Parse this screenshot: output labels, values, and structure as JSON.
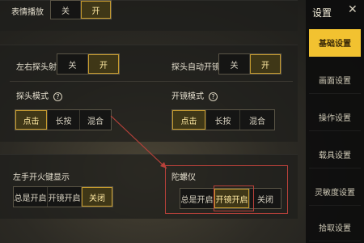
{
  "rows": {
    "top": {
      "label": "表情播放",
      "options": [
        "关",
        "开"
      ],
      "selected": 1
    },
    "lean_fire": {
      "label": "左右探头射击",
      "options": [
        "关",
        "开"
      ],
      "selected": 1
    },
    "auto_open_door": {
      "label": "探头自动开镜",
      "options": [
        "关",
        "开"
      ],
      "selected": 1
    },
    "peek_mode": {
      "label": "探头模式",
      "help": "?",
      "options": [
        "点击",
        "长按",
        "混合"
      ],
      "selected": 0
    },
    "scope_mode": {
      "label": "开镜模式",
      "help": "?",
      "options": [
        "点击",
        "长按",
        "混合"
      ],
      "selected": 0
    },
    "fire_button": {
      "label": "左手开火键显示",
      "options": [
        "总是开启",
        "开镜开启",
        "关闭"
      ],
      "selected": 2
    },
    "gyroscope": {
      "label": "陀螺仪",
      "options": [
        "总是开启",
        "开镜开启",
        "关闭"
      ],
      "selected": 1
    }
  },
  "sidebar": {
    "title": "设置",
    "close_icon": "✕",
    "items": [
      {
        "label": "基础设置",
        "active": true
      },
      {
        "label": "画面设置",
        "active": false
      },
      {
        "label": "操作设置",
        "active": false
      },
      {
        "label": "载具设置",
        "active": false
      },
      {
        "label": "灵敏度设置",
        "active": false
      },
      {
        "label": "拾取设置",
        "active": false
      }
    ]
  },
  "colors": {
    "accent": "#f2c230",
    "selected_border": "#c59a2e",
    "annotation": "#b8413a"
  }
}
